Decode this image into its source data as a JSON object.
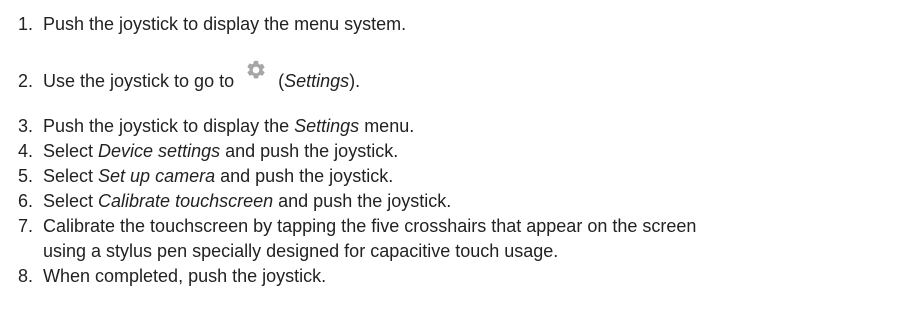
{
  "steps": [
    {
      "num": "1.",
      "text": "Push the joystick to display the menu system."
    },
    {
      "num": "2.",
      "before": "Use the joystick to go to ",
      "icon": "gear-icon",
      "after_open": " (",
      "em": "Settings",
      "after_close": ")."
    },
    {
      "num": "3.",
      "before": "Push the joystick to display the ",
      "em": "Settings",
      "after": " menu."
    },
    {
      "num": "4.",
      "before": "Select ",
      "em": "Device settings",
      "after": " and push the joystick."
    },
    {
      "num": "5.",
      "before": "Select ",
      "em": "Set up camera",
      "after": " and push the joystick."
    },
    {
      "num": "6.",
      "before": "Select ",
      "em": "Calibrate touchscreen",
      "after": " and push the joystick."
    },
    {
      "num": "7.",
      "line1": "Calibrate the touchscreen by tapping the five crosshairs that appear on the screen",
      "line2": "using a stylus pen specially designed for capacitive touch usage."
    },
    {
      "num": "8.",
      "text": "When completed, push the joystick."
    }
  ],
  "colors": {
    "text": "#222222",
    "icon": "#a6a6a6"
  }
}
